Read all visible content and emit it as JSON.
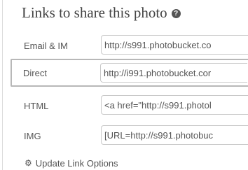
{
  "panel": {
    "title": "Links to share this photo",
    "help_icon_glyph": "?",
    "help_icon_name": "help-icon"
  },
  "links": [
    {
      "label": "Email & IM",
      "value": "http://s991.photobucket.co"
    },
    {
      "label": "Direct",
      "value": "http://i991.photobucket.cor"
    },
    {
      "label": "HTML",
      "value": "<a href=\"http://s991.photol"
    },
    {
      "label": "IMG",
      "value": "[URL=http://s991.photobuc"
    }
  ],
  "update": {
    "label": "Update Link Options",
    "icon_glyph": "⚙",
    "icon_name": "gear-icon"
  },
  "colors": {
    "text": "#555555",
    "title": "#444444",
    "border": "#c9c9c9",
    "highlight_border": "#b8b8b8"
  }
}
